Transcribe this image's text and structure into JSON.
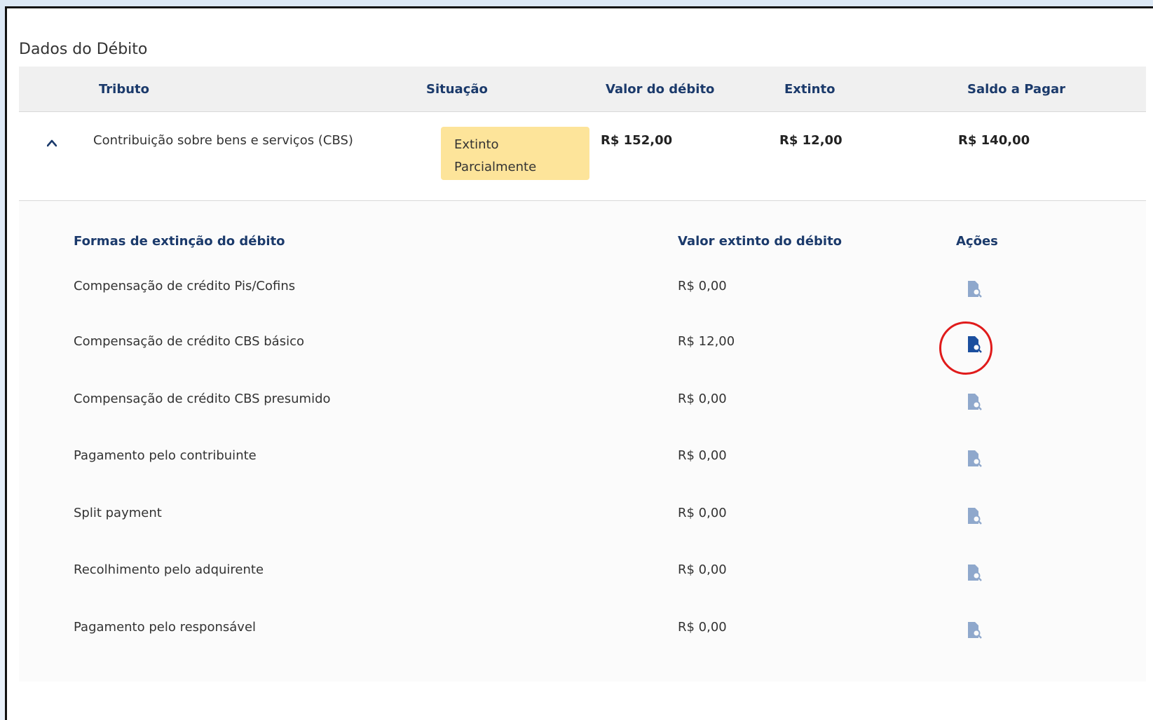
{
  "section_title": "Dados do Débito",
  "table": {
    "headers": {
      "tributo": "Tributo",
      "situacao": "Situação",
      "valor_debito": "Valor do débito",
      "extinto": "Extinto",
      "saldo_pagar": "Saldo a Pagar"
    },
    "row": {
      "tributo": "Contribuição sobre bens e serviços (CBS)",
      "situacao_line1": "Extinto",
      "situacao_line2": "Parcialmente",
      "valor_debito": "R$ 152,00",
      "extinto": "R$ 12,00",
      "saldo_pagar": "R$ 140,00"
    }
  },
  "detail": {
    "headers": {
      "formas": "Formas de extinção do débito",
      "valor_extinto": "Valor extinto do débito",
      "acoes": "Ações"
    },
    "rows": [
      {
        "label": "Compensação de crédito Pis/Cofins",
        "value": "R$ 0,00"
      },
      {
        "label": "Compensação de crédito CBS básico",
        "value": "R$ 12,00"
      },
      {
        "label": "Compensação de crédito CBS presumido",
        "value": "R$ 0,00"
      },
      {
        "label": "Pagamento pelo contribuinte",
        "value": "R$ 0,00"
      },
      {
        "label": "Split payment",
        "value": "R$ 0,00"
      },
      {
        "label": "Recolhimento pelo adquirente",
        "value": "R$ 0,00"
      },
      {
        "label": "Pagamento pelo responsável",
        "value": "R$ 0,00"
      }
    ],
    "active_row_index": 1
  },
  "colors": {
    "header_text": "#1b3a6b",
    "badge_bg": "#fde49a",
    "icon_inactive": "#8fa8cc",
    "icon_active": "#1b4f9e",
    "highlight": "#e01b1b"
  },
  "icons": {
    "collapse": "chevron-up-icon",
    "action": "document-search-icon"
  }
}
